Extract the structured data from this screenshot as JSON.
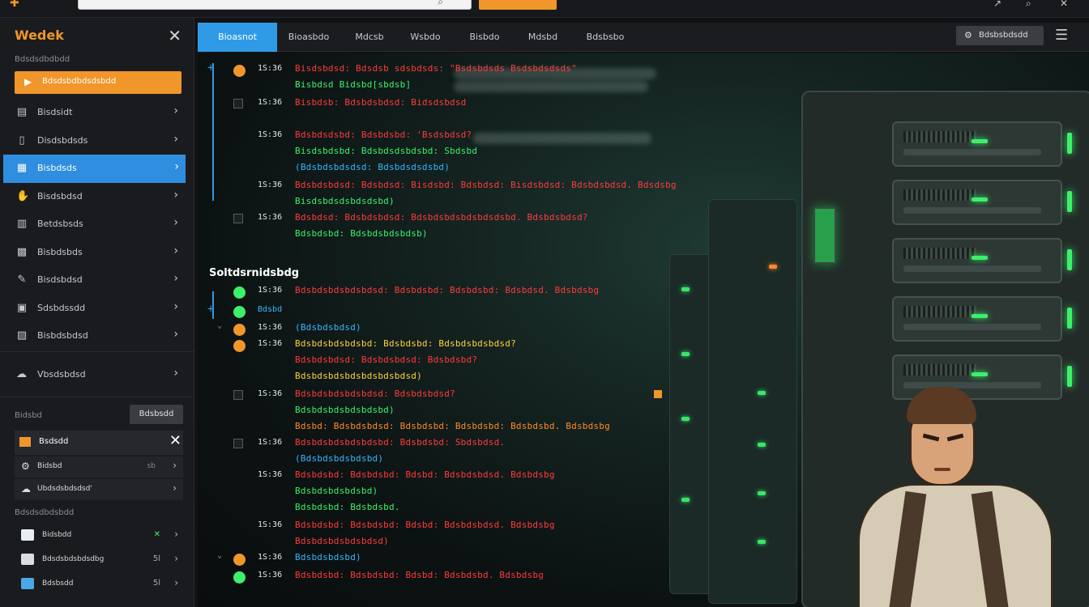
{
  "topbar": {
    "search_placeholder": "",
    "cta_label": ""
  },
  "sidebar": {
    "title": "Wedek",
    "caption": "Bdsdsdbdbdd",
    "active_item": "Bdsdsbdbdsdsbdd",
    "items": [
      {
        "label": "Bisdsidt",
        "icon": "document-icon"
      },
      {
        "label": "Disdsbdsds",
        "icon": "file-icon"
      },
      {
        "label": "Bisbdsds",
        "icon": "server-icon"
      },
      {
        "label": "Bisdsbdsd",
        "icon": "hand-icon"
      },
      {
        "label": "Betdsbsds",
        "icon": "chart-icon"
      },
      {
        "label": "Bisbdsbds",
        "icon": "grid-icon"
      },
      {
        "label": "Bisdsbdsd",
        "icon": "pen-icon"
      },
      {
        "label": "Sdsbdssdd",
        "icon": "monitor-icon"
      },
      {
        "label": "Bisbdsbdsd",
        "icon": "image-icon"
      }
    ],
    "extra_item": {
      "label": "Vbsdsbdsd",
      "icon": "cloud-icon"
    },
    "section_caption": "Bidsbd",
    "section_button": "Bdsbsdd",
    "panel_label": "Bsdsdd",
    "sub_rows": [
      {
        "label": "Bidsbd",
        "meta": "sb"
      },
      {
        "label": "Ubdsdsbdsdsd'",
        "meta": ""
      }
    ],
    "list_caption": "Bdsdsdbdsbdd",
    "list_rows": [
      {
        "label": "Bidsbdd",
        "meta": "✕"
      },
      {
        "label": "Bdsdsbdsbdsdbg",
        "meta": "5l"
      },
      {
        "label": "Bdsbsdd",
        "meta": "5l"
      }
    ]
  },
  "tabs": {
    "items": [
      "Bioasnot",
      "Bioasbdo",
      "Mdcsb",
      "Wsbdo",
      "Bisbdo",
      "Mdsbd",
      "Bdsbsbo"
    ],
    "right_button": "Bdsbsbdsdd"
  },
  "log": {
    "heading": "Soltdsrnidsbdg",
    "rows": [
      {
        "time": "1S:36",
        "lines": [
          "Bisdsbdsd: Bdsdsb sdsbdsds: \"Bsdsbdsds Bsdsbdsdsds\"",
          "Bisbdsd Bidsbd[sbdsb]"
        ]
      },
      {
        "time": "1S:36",
        "lines": [
          "Bisbdsb: Bdsbdsbdsd: Bidsdsbdsd"
        ]
      },
      {
        "time": "1S:36",
        "lines": [
          "Bdsbdsdsbd: Bdsbdsbd: 'Bsdsbdsd?",
          "Bisdsbdsbd: Bdsbdsdsbdsbd: Sbdsbd",
          "(Bdsbdsbdsdsd: Bdsbdsdsdsbd)"
        ]
      },
      {
        "time": "1S:36",
        "lines": [
          "Bdsbdsbdsd: Bdsbdsd: Bisdsbd: Bdsbdsd: Bisdsbdsd: Bdsbdsbdsd. Bdsdsbg",
          "Bisdsbdsdsbdsdsbd)"
        ]
      },
      {
        "time": "1S:36",
        "lines": [
          "Bdsbdsd: Bdsbdsbdsd: Bdsbdsbdsbdsbdsdsbd. Bdsbdsbdsd?",
          "Bdsbdsbd: Bdsbdsbdsbdsb)"
        ]
      },
      {
        "time": "1S:36",
        "lines": [
          "Bdsbdsbdsbdsbdsd: Bdsbdsbd: Bdsbdsbd: Bdsbdsd. Bdsbdsbg"
        ]
      },
      {
        "time": "Bdsbd",
        "lines": []
      },
      {
        "time": "1S:36",
        "lines": [
          "(Bdsbdsbdsd)"
        ]
      },
      {
        "time": "1S:36",
        "lines": [
          "Bdsbdsbdsbdsbd: Bdsbdsbd: Bdsbdsbdsbdsd?",
          "Bdsbdsbdsd: Bdsbdsbdsd: Bdsbdsbd?",
          "Bdsbdsbdsbdsbdsbdsbdsd)"
        ]
      },
      {
        "time": "1S:36",
        "lines": [
          "Bdsbdsbdsbdsbdsd: Bdsbdsbdsd?",
          "Bdsbdsbdsbdsbdsbd)",
          "Bdsbd: Bdsbdsbdsd: Bdsbdsbd: Bdsbdsbd: Bdsbdsbd. Bdsbdsbg"
        ]
      },
      {
        "time": "1S:36",
        "lines": [
          "Bdsbdsbdsbdsbdsbd: Bdsbdsbd: Sbdsbdsd.",
          "(Bdsbdsbdsbdsbd)"
        ]
      },
      {
        "time": "1S:36",
        "lines": [
          "Bdsbdsbd: Bdsbdsbd: Bdsbd: Bdsbdsbdsd. Bdsbdsbg",
          "Bdsbdsbdsbdsbd)",
          "Bdsbdsbd: Bdsbdsbd."
        ]
      },
      {
        "time": "1S:36",
        "lines": [
          "Bdsbdsbd: Bdsbdsbd: Bdsbd: Bdsbdsbdsd. Bdsbdsbg",
          "Bdsbdsbdsbdsbdsd)"
        ]
      },
      {
        "time": "1S:36",
        "lines": [
          "Bdsbdsbdsbd)"
        ]
      },
      {
        "time": "1S:36",
        "lines": [
          "Bdsbdsbd: Bdsbdsbd: Bdsbd: Bdsbdsbd. Bdsbdsbg"
        ]
      }
    ]
  },
  "colors": {
    "accent_orange": "#f0962a",
    "accent_blue": "#2f9be6",
    "log_red": "#ff3b3b",
    "log_green": "#3cf06c"
  }
}
